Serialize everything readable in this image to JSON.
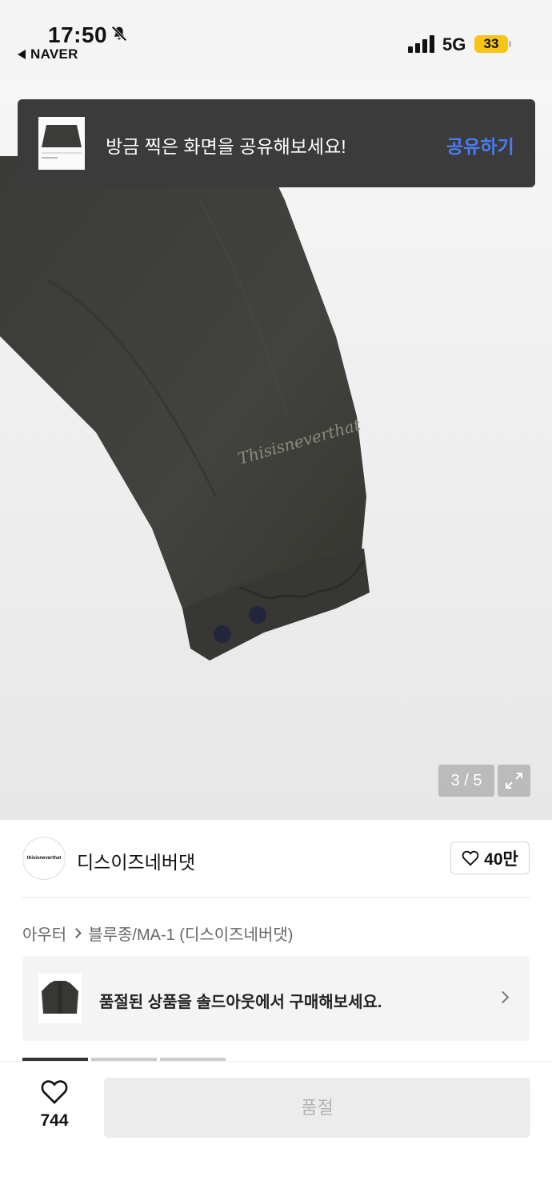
{
  "status_bar": {
    "time": "17:50",
    "back_app": "NAVER",
    "network": "5G",
    "battery": "33",
    "icons": [
      "bell-slash-icon",
      "signal-icon"
    ]
  },
  "toast": {
    "message": "방금 찍은 화면을 공유해보세요!",
    "action": "공유하기",
    "colors": {
      "background": "#3b3b3c",
      "action": "#4a7cf0"
    }
  },
  "gallery": {
    "counter": "3 / 5",
    "watermark": "Thisisneverthat",
    "expand_icon": "expand-icon"
  },
  "brand": {
    "avatar_text": "thisisneverthat",
    "name": "디스이즈네버댓",
    "likes": "40만"
  },
  "breadcrumb": {
    "category": "아우터",
    "sub_category": "블루종/MA-1 (디스이즈네버댓)"
  },
  "soldout": {
    "message": "품절된 상품을 솔드아웃에서 구매해보세요."
  },
  "bottom_bar": {
    "wish_count": "744",
    "buy_label": "품절"
  }
}
